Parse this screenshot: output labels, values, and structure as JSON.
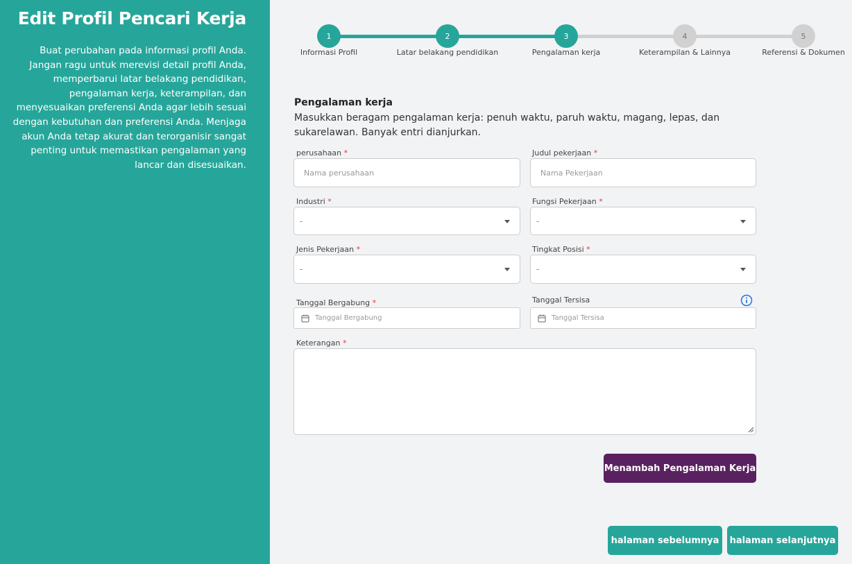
{
  "sidebar": {
    "title": "Edit Profil Pencari Kerja",
    "description": "Buat perubahan pada informasi profil Anda. Jangan ragu untuk merevisi detail profil Anda, memperbarui latar belakang pendidikan, pengalaman kerja, keterampilan, dan menyesuaikan preferensi Anda agar lebih sesuai dengan kebutuhan dan preferensi Anda. Menjaga akun Anda tetap akurat dan terorganisir sangat penting untuk memastikan pengalaman yang lancar dan disesuaikan."
  },
  "stepper": {
    "current": 3,
    "steps": [
      {
        "number": "1",
        "label": "Informasi Profil"
      },
      {
        "number": "2",
        "label": "Latar belakang pendidikan"
      },
      {
        "number": "3",
        "label": "Pengalaman kerja"
      },
      {
        "number": "4",
        "label": "Keterampilan & Lainnya"
      },
      {
        "number": "5",
        "label": "Referensi & Dokumen"
      }
    ]
  },
  "section": {
    "title": "Pengalaman kerja",
    "description": "Masukkan beragam pengalaman kerja: penuh waktu, paruh waktu, magang, lepas, dan sukarelawan. Banyak entri dianjurkan."
  },
  "form": {
    "required_mark": "*",
    "company": {
      "label": "perusahaan",
      "placeholder": "Nama perusahaan"
    },
    "job_title": {
      "label": "Judul pekerjaan",
      "placeholder": "Nama Pekerjaan"
    },
    "industry": {
      "label": "Industri",
      "value": "-"
    },
    "job_function": {
      "label": "Fungsi Pekerjaan",
      "value": "-"
    },
    "job_type": {
      "label": "Jenis Pekerjaan",
      "value": "-"
    },
    "position_level": {
      "label": "Tingkat Posisi",
      "value": "-"
    },
    "join_date": {
      "label": "Tanggal Bergabung",
      "placeholder": "Tanggal Bergabung"
    },
    "end_date": {
      "label": "Tanggal Tersisa",
      "placeholder": "Tanggal Tersisa"
    },
    "description": {
      "label": "Keterangan",
      "value": ""
    }
  },
  "buttons": {
    "add_experience": "Menambah Pengalaman Kerja",
    "previous": "halaman sebelumnya",
    "next": "halaman selanjutnya"
  },
  "colors": {
    "primary": "#26a69a",
    "accent": "#5a2160",
    "inactive": "#d1d1d1",
    "required": "#e53935",
    "info": "#1e73e8"
  },
  "icons": {
    "select_caret": "chevron-down-icon",
    "date_field": "calendar-icon",
    "info": "info-icon"
  }
}
